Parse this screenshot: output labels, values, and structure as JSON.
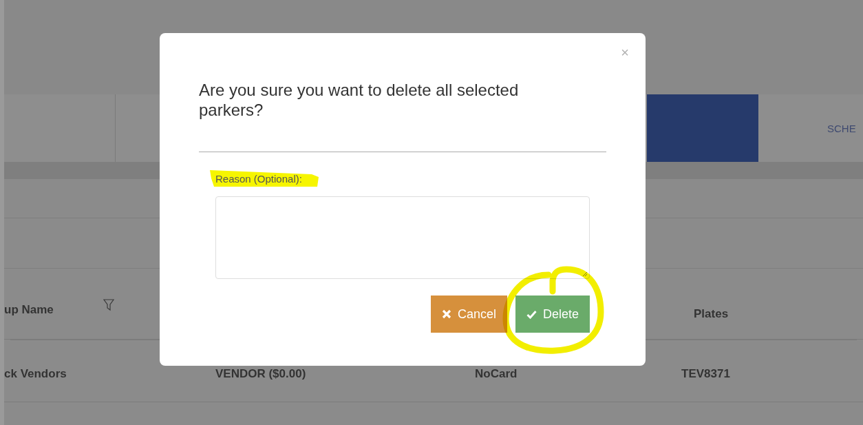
{
  "page": {
    "tabs": [
      {
        "selected": false
      },
      {
        "selected": true
      },
      {
        "label": "SCHE",
        "selected": false
      }
    ],
    "table": {
      "header": [
        "up Name",
        "Plates"
      ],
      "rows": [
        {
          "cells": [
            "ck Vendors",
            "VENDOR ($0.00)",
            "NoCard",
            "TEV8371"
          ]
        }
      ]
    }
  },
  "dialog": {
    "message": "Are you sure you want to delete all selected parkers?",
    "close": "×",
    "field": {
      "label": "Reason (Optional):"
    },
    "buttons": [
      {
        "kind": "cancel",
        "label": "Cancel"
      },
      {
        "kind": "confirm",
        "label": "Delete"
      }
    ]
  },
  "annotations": [
    {
      "kind": "highlight"
    },
    {
      "kind": "circle"
    }
  ]
}
